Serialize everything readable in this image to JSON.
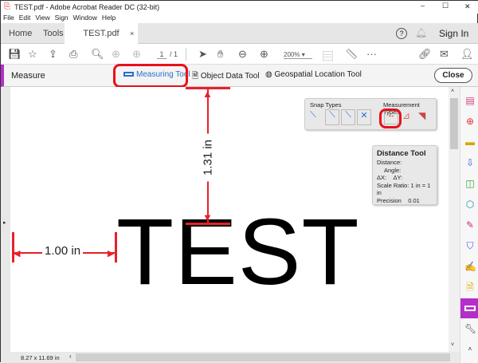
{
  "window": {
    "title": "TEST.pdf - Adobe Acrobat Reader DC (32-bit)",
    "minimize": "–",
    "maximize": "☐",
    "close": "✕"
  },
  "menu": [
    "File",
    "Edit",
    "View",
    "Sign",
    "Window",
    "Help"
  ],
  "tabs": {
    "home": "Home",
    "tools": "Tools",
    "doc": "TEST.pdf",
    "doc_close": "×",
    "help": "?",
    "sign_in": "Sign In"
  },
  "toolbar": {
    "page_current": "1",
    "page_total": "/ 1",
    "zoom": "200%",
    "more": "···"
  },
  "measure": {
    "title": "Measure",
    "measuring_tool": "Measuring Tool",
    "object_data_tool": "Object Data Tool",
    "geospatial_tool": "Geospatial Location Tool",
    "close": "Close"
  },
  "snap": {
    "snap_label": "Snap Types",
    "measurement_label": "Measurement Types"
  },
  "distance_panel": {
    "title": "Distance Tool",
    "distance": "Distance:",
    "angle": "Angle:",
    "dx": "ΔX:",
    "dy": "ΔY:",
    "scale": "Scale Ratio: 1 in = 1 in",
    "precision_label": "Precision",
    "precision_value": "0.01"
  },
  "document": {
    "text": "TEST",
    "horizontal_measure": "1.00 in",
    "vertical_measure": "1.31 in"
  },
  "status": {
    "page_size": "8.27 x 11.69 in"
  },
  "colors": {
    "accent": "#b42fc8",
    "annotation": "#e8202a"
  }
}
